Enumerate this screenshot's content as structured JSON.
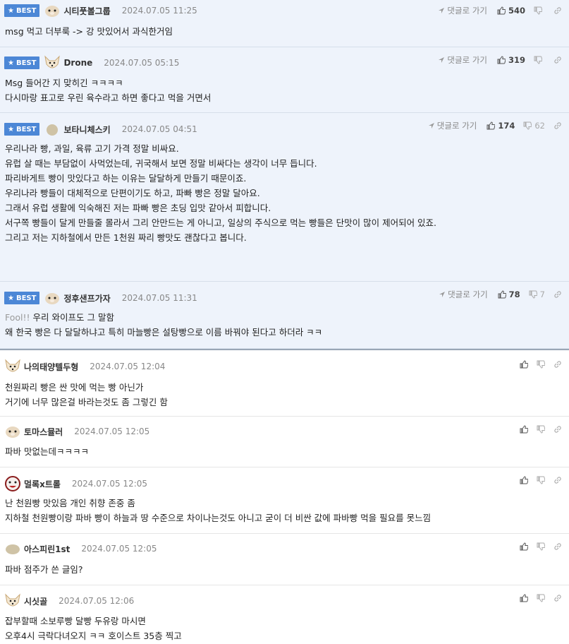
{
  "labels": {
    "best": "BEST",
    "reply": "댓글로 가기"
  },
  "best_comments": [
    {
      "nick": "시티풋볼그룹",
      "date": "2024.07.05 11:25",
      "up": "540",
      "down": "",
      "avatar": "hamster",
      "lines": [
        "msg 먹고 더부룩 -> 강 맛있어서 과식한거임"
      ]
    },
    {
      "nick": "Drone",
      "date": "2024.07.05 05:15",
      "up": "319",
      "down": "",
      "avatar": "dog",
      "lines": [
        "Msg 들어간 지 맞히긴 ㅋㅋㅋㅋ",
        "다시마랑 표고로 우린 육수라고 하면 좋다고 먹을 거면서"
      ]
    },
    {
      "nick": "보타니체스키",
      "date": "2024.07.05 04:51",
      "up": "174",
      "down": "62",
      "avatar": "blob",
      "lines": [
        "우리나라 빵, 과일, 육류 고기 가격 정말 비싸요.",
        "유럽 살 때는 부담없이 사먹었는데, 귀국해서 보면 정말 비싸다는 생각이 너무 듭니다.",
        "",
        "파리바게트 빵이 맛있다고 하는 이유는 달달하게 만들기 때문이죠.",
        "우리나라 빵들이 대체적으로 단편이기도 하고, 파빠 빵은 정말 달아요.",
        "그래서 유럽 생활에 익숙해진 저는 파빠 빵은 초딩 입맛 같아서 피합니다.",
        "",
        "서구쪽 빵들이 달게 만들줄 몰라서 그리 안만드는 게 아니고, 일상의 주식으로 먹는 빵들은 단맛이 많이 제어되어 있죠.",
        "그리고 저는 지하철에서 만든 1천원 짜리 빵맛도 괜찮다고 봅니다."
      ]
    },
    {
      "nick": "정후샌프가자",
      "date": "2024.07.05 11:31",
      "up": "78",
      "down": "7",
      "avatar": "hamster",
      "quote": "Fool!!",
      "lines": [
        "우리 와이프도 그 말함",
        "왜 한국 빵은 다 달달하냐고 특히 마늘빵은 설탕빵으로 이름 바꿔야 된다고 하더라 ㅋㅋ"
      ]
    }
  ],
  "comments": [
    {
      "nick": "나의태양텔두형",
      "date": "2024.07.05 12:04",
      "avatar": "dog",
      "lines": [
        "천원짜리 빵은 싼 맛에 먹는 빵 아닌가",
        "거기에 너무 많은걸 바라는것도 좀 그렇긴 함"
      ]
    },
    {
      "nick": "토마스뮬러",
      "date": "2024.07.05 12:05",
      "avatar": "hamster",
      "lines": [
        "파바 맛없는데ㅋㅋㅋㅋ"
      ]
    },
    {
      "nick": "멀록x트롤",
      "date": "2024.07.05 12:05",
      "avatar": "clown",
      "lines": [
        "난 천원빵 맛있음 개인 취향 존중 좀",
        "지하철 천원빵이랑 파바 빵이 하늘과 땅 수준으로 차이나는것도 아니고 굳이 더 비싼 값에 파바빵 먹을 필요를 못느낌"
      ]
    },
    {
      "nick": "아스피린1st",
      "date": "2024.07.05 12:05",
      "avatar": "blob",
      "lines": [
        "파바 점주가 쓴 글임?"
      ]
    },
    {
      "nick": "시싯골",
      "date": "2024.07.05 12:06",
      "avatar": "dog",
      "lines": [
        "잡부할때 소보루빵 달빵 두유랑 마시면",
        "오후4시 극락다녀오지 ㅋㅋ 호이스트 35층 찍고"
      ]
    }
  ]
}
